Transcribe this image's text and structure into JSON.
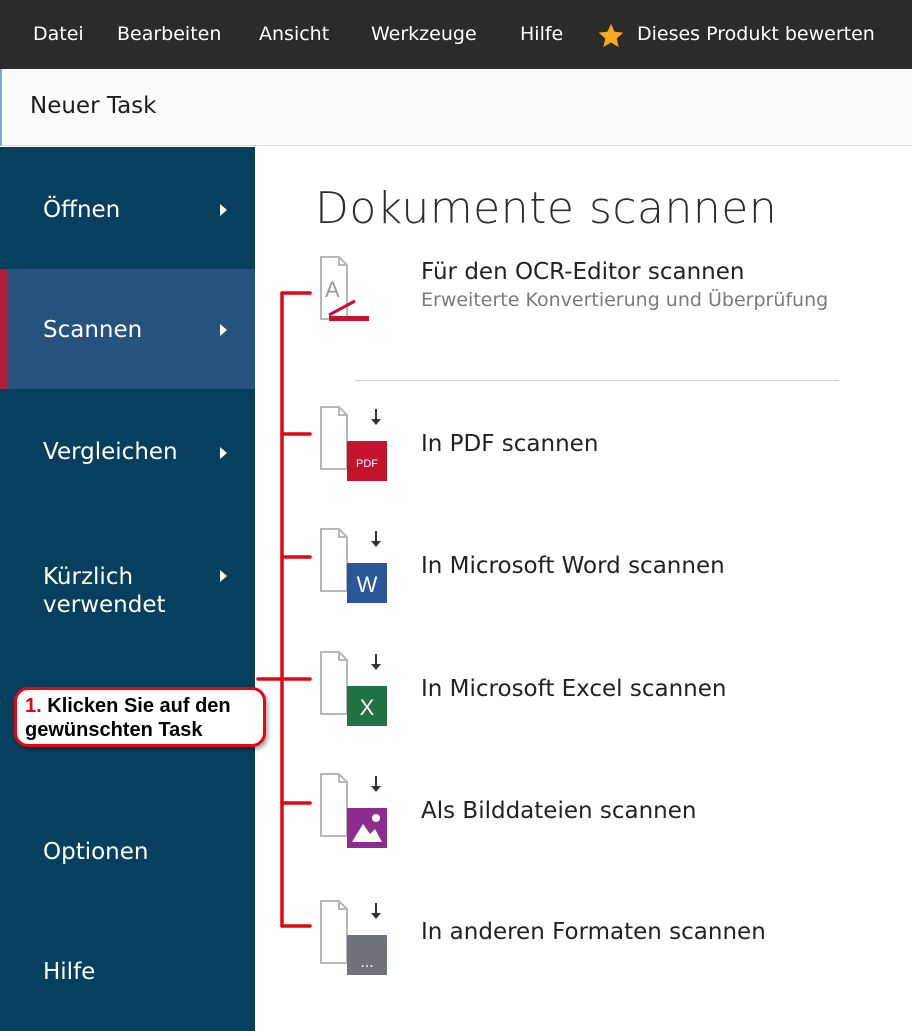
{
  "menubar": {
    "items": [
      "Datei",
      "Bearbeiten",
      "Ansicht",
      "Werkzeuge",
      "Hilfe"
    ],
    "rate_label": "Dieses Produkt bewerten",
    "rate_icon": "star-icon",
    "star_color": "#f7a823"
  },
  "task_tab": {
    "title": "Neuer Task"
  },
  "sidebar": {
    "items": [
      {
        "label": "Öffnen",
        "has_chevron": true
      },
      {
        "label": "Scannen",
        "has_chevron": true,
        "active": true
      },
      {
        "label": "Vergleichen",
        "has_chevron": true
      },
      {
        "label_line1": "Kürzlich",
        "label_line2": "verwendet",
        "has_chevron": true
      },
      {
        "label": "Optionen"
      },
      {
        "label": "Hilfe"
      }
    ]
  },
  "main": {
    "title": "Dokumente scannen",
    "tasks": [
      {
        "label": "Für den OCR-Editor scannen",
        "sublabel": "Erweiterte Konvertierung und Überprüfung",
        "icon": "ocr-editor-scan-icon"
      },
      {
        "label": "In PDF scannen",
        "icon": "pdf-scan-icon",
        "badge": "PDF"
      },
      {
        "label": "In Microsoft Word scannen",
        "icon": "word-scan-icon",
        "badge": "W"
      },
      {
        "label": "In Microsoft Excel scannen",
        "icon": "excel-scan-icon",
        "badge": "X"
      },
      {
        "label": "Als Bilddateien scannen",
        "icon": "image-scan-icon"
      },
      {
        "label": "In anderen Formaten scannen",
        "icon": "other-format-scan-icon",
        "badge": "..."
      }
    ]
  },
  "callout": {
    "number": "1.",
    "line1": "Klicken Sie auf den",
    "line2": "gewünschten Task"
  },
  "colors": {
    "menubar_bg": "#2b2b2b",
    "sidebar_bg": "#07405e",
    "sidebar_active_bg": "#25537d",
    "active_marker": "#b01e3a",
    "pdf_badge": "#c4122f",
    "word_badge": "#2b579a",
    "excel_badge": "#217346",
    "image_badge": "#8e2d8f",
    "other_badge": "#6d7378",
    "annotation_red": "#e30613"
  }
}
